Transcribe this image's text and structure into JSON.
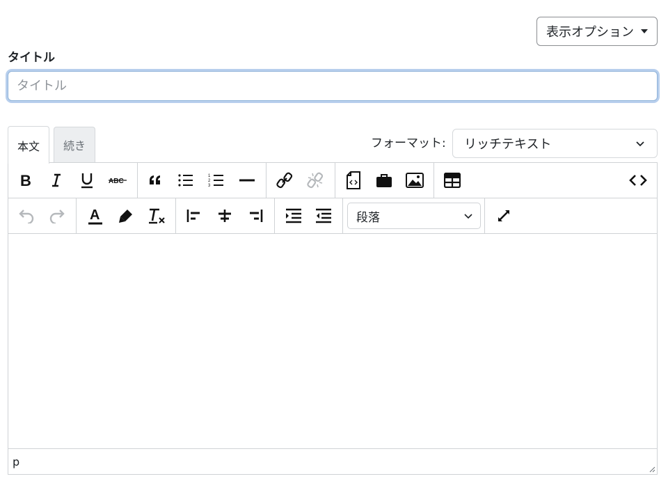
{
  "header": {
    "display_options_label": "表示オプション"
  },
  "title": {
    "label": "タイトル",
    "placeholder": "タイトル",
    "value": ""
  },
  "tabs": [
    {
      "label": "本文",
      "active": true
    },
    {
      "label": "続き",
      "active": false
    }
  ],
  "format": {
    "label": "フォーマット:",
    "selected": "リッチテキスト"
  },
  "toolbar": {
    "row1": [
      "bold-icon",
      "italic-icon",
      "underline-icon",
      "strikethrough-icon",
      "blockquote-icon",
      "bullet-list-icon",
      "numbered-list-icon",
      "horizontal-rule-icon",
      "link-icon",
      "unlink-icon",
      "code-snippet-icon",
      "briefcase-icon",
      "image-icon",
      "table-icon",
      "source-code-icon"
    ],
    "row2": [
      "undo-icon",
      "redo-icon",
      "text-color-icon",
      "highlight-icon",
      "clear-format-icon",
      "align-left-icon",
      "align-center-icon",
      "align-right-icon",
      "indent-icon",
      "outdent-icon",
      "fullscreen-icon"
    ],
    "paragraph_selected": "段落"
  },
  "statusbar": {
    "path": "p"
  },
  "colors": {
    "focus_ring": "#6195d8",
    "border": "#cfd2d5",
    "icon": "#111111",
    "disabled_icon": "#b5b8bb"
  }
}
